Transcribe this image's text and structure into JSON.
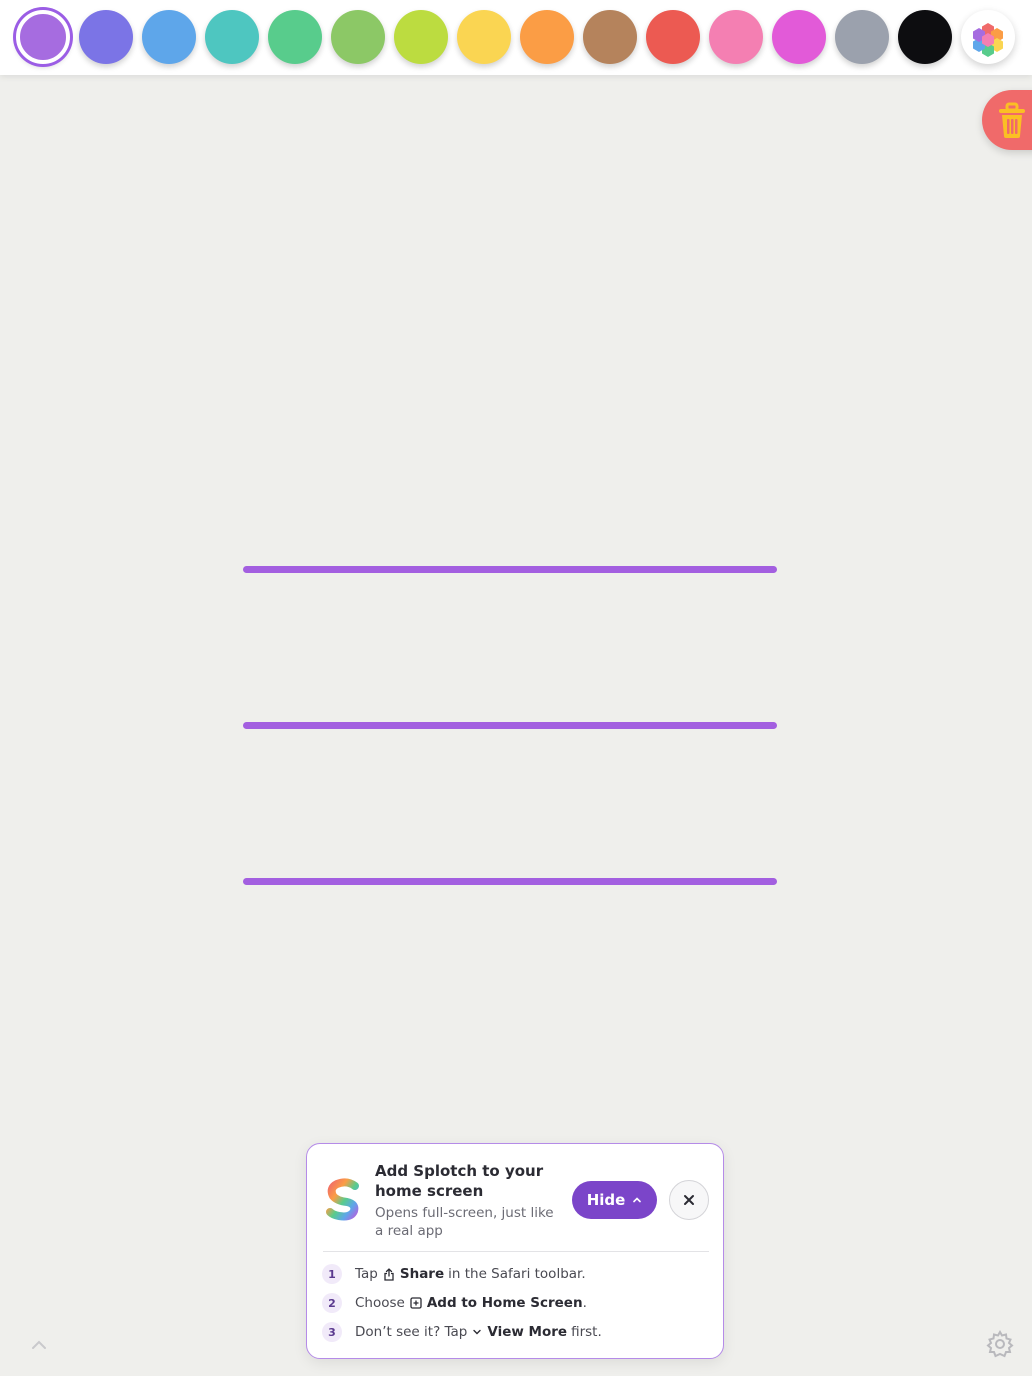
{
  "palette": {
    "colors": [
      {
        "name": "purple",
        "hex": "#a66ce0",
        "selected": true
      },
      {
        "name": "indigo",
        "hex": "#7b74e6"
      },
      {
        "name": "blue",
        "hex": "#5ea6ea"
      },
      {
        "name": "teal",
        "hex": "#4ec6c0"
      },
      {
        "name": "green",
        "hex": "#58cc8c"
      },
      {
        "name": "olive-green",
        "hex": "#8cc866"
      },
      {
        "name": "lime",
        "hex": "#bcdc40"
      },
      {
        "name": "yellow",
        "hex": "#fad552"
      },
      {
        "name": "orange",
        "hex": "#fb9d45"
      },
      {
        "name": "brown",
        "hex": "#b5835c"
      },
      {
        "name": "red",
        "hex": "#ec5a52"
      },
      {
        "name": "pink",
        "hex": "#f47fb2"
      },
      {
        "name": "magenta",
        "hex": "#e25ad8"
      },
      {
        "name": "gray",
        "hex": "#9ba1ad"
      },
      {
        "name": "black",
        "hex": "#0d0d10"
      }
    ],
    "more_colors_icon": "hexagon-palette-icon"
  },
  "canvas": {
    "stroke_color": "#a35fe0",
    "stroke_count": 3
  },
  "actions": {
    "clear_icon": "trash-icon",
    "settings_icon": "gear-icon",
    "collapse_icon": "chevron-up-icon"
  },
  "install_prompt": {
    "title": "Add Splotch to your home screen",
    "subtitle": "Opens full-screen, just like a real app",
    "hide_label": "Hide",
    "accent": "#7b45c9",
    "steps": [
      {
        "num": "1",
        "before": "Tap",
        "bold": "Share",
        "after": "in the Safari toolbar."
      },
      {
        "num": "2",
        "before": "Choose",
        "bold": "Add to Home Screen",
        "after": "."
      },
      {
        "num": "3",
        "before": "Don’t see it? Tap",
        "bold": "View More",
        "after": "first."
      }
    ]
  }
}
